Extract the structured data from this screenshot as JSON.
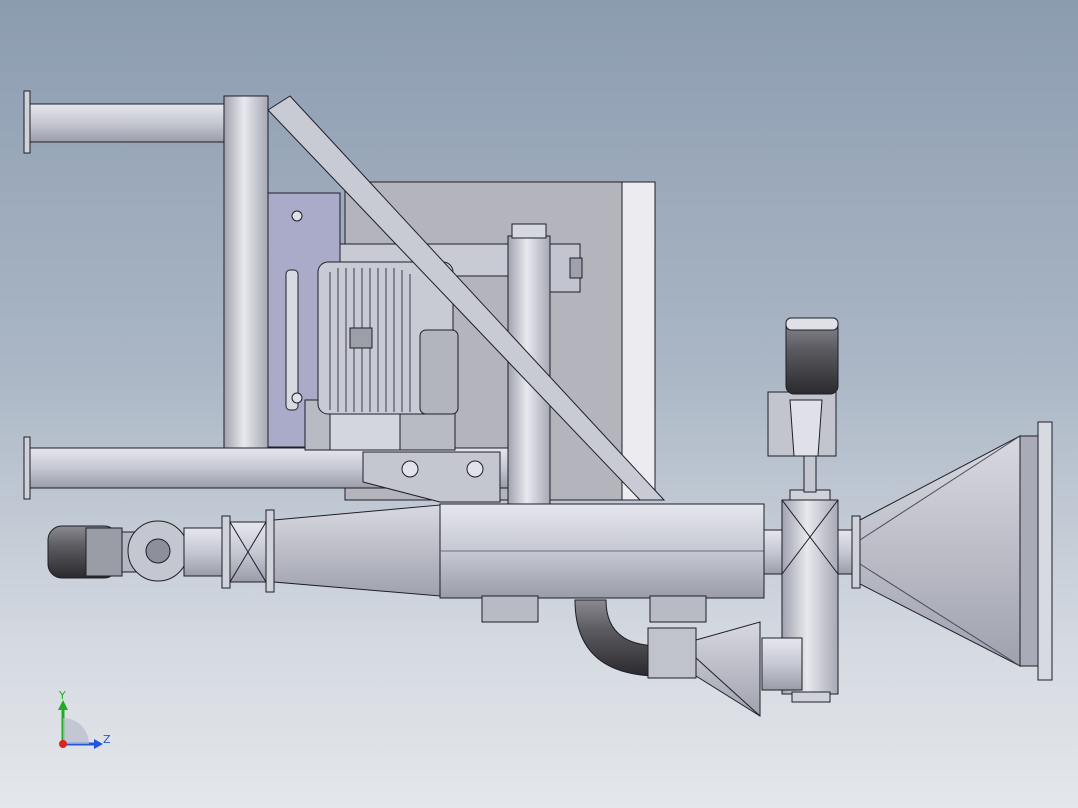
{
  "viewport": {
    "background_top": "#8c9cb0",
    "background_bottom": "#e4e7eb"
  },
  "triad": {
    "y_label": "Y",
    "z_label": "Z",
    "y_color": "#22aa22",
    "z_color": "#2255dd",
    "x_color": "#dd2222"
  },
  "model": {
    "steel_color": "#c9ccd6",
    "edge_color": "#1e1e28",
    "plate_color": "#a9abc9",
    "housing_color": "#b4b4bc"
  }
}
